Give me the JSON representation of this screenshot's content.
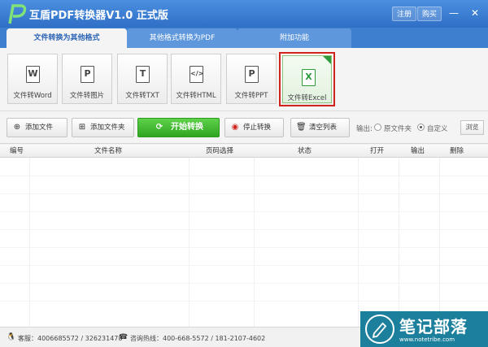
{
  "window": {
    "title": "互盾PDF转换器V1.0 正式版",
    "register_label": "注册",
    "buy_label": "购买",
    "minimize_glyph": "—",
    "close_glyph": "✕"
  },
  "tabs": [
    {
      "label": "文件转换为其他格式",
      "active": true
    },
    {
      "label": "其他格式转换为PDF",
      "active": false
    },
    {
      "label": "附加功能",
      "active": false
    }
  ],
  "formats": [
    {
      "label": "文件转Word",
      "icon": "word-icon",
      "glyph": "W",
      "selected": false
    },
    {
      "label": "文件转图片",
      "icon": "image-icon",
      "glyph": "P",
      "selected": false
    },
    {
      "label": "文件转TXT",
      "icon": "txt-icon",
      "glyph": "T",
      "selected": false
    },
    {
      "label": "文件转HTML",
      "icon": "html-icon",
      "glyph": "</>",
      "selected": false
    },
    {
      "label": "文件转PPT",
      "icon": "ppt-icon",
      "glyph": "P",
      "selected": false
    },
    {
      "label": "文件转Excel",
      "icon": "excel-icon",
      "glyph": "X",
      "selected": true
    }
  ],
  "toolbar": {
    "add_file": "添加文件",
    "add_folder": "添加文件夹",
    "start": "开始转换",
    "stop": "停止转换",
    "clear": "清空列表",
    "output_label": "输出:",
    "option_source": "原文件夹",
    "option_custom": "自定义",
    "browse": "浏览"
  },
  "table": {
    "columns": [
      "编号",
      "文件名称",
      "页码选择",
      "状态",
      "打开",
      "输出",
      "删除"
    ],
    "rows": []
  },
  "status": {
    "support": "客服：4006685572 / 326231478",
    "hotline": "咨询热线：400-668-5572 / 181-2107-4602"
  },
  "watermark": {
    "title": "笔记部落",
    "url": "www.notetribe.com"
  },
  "colors": {
    "accent": "#3f7fd0",
    "start_button": "#3cb62b",
    "selected_border": "#d0231d"
  }
}
